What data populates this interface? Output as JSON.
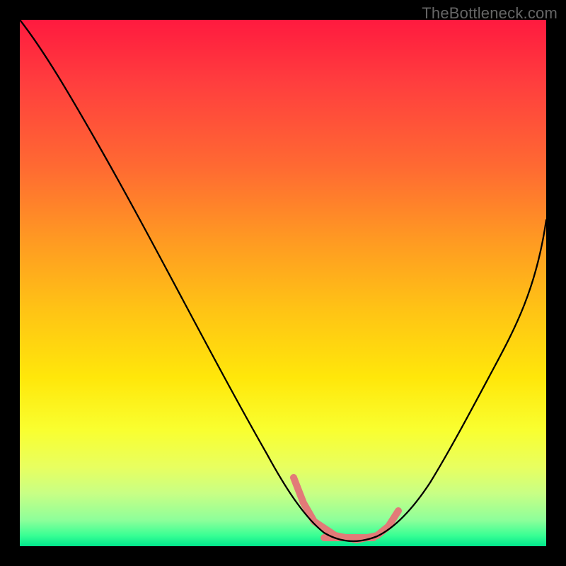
{
  "watermark": "TheBottleneck.com",
  "chart_data": {
    "type": "line",
    "title": "",
    "xlabel": "",
    "ylabel": "",
    "xlim": [
      0,
      100
    ],
    "ylim": [
      0,
      100
    ],
    "series": [
      {
        "name": "bottleneck-curve",
        "x": [
          0,
          6,
          12,
          18,
          24,
          30,
          36,
          42,
          48,
          52,
          56,
          60,
          64,
          68,
          72,
          76,
          80,
          85,
          90,
          95,
          100
        ],
        "values": [
          100,
          92,
          83,
          74,
          65,
          55,
          45,
          34,
          22,
          13,
          6,
          2,
          1,
          1,
          2,
          6,
          13,
          23,
          35,
          48,
          62
        ]
      }
    ],
    "highlight_range_x": [
      52,
      70
    ],
    "highlight_values": [
      13,
      6,
      2,
      1,
      1,
      2
    ],
    "background_gradient": {
      "top": "#ff1a3f",
      "mid": "#ffe70a",
      "bottom": "#00e68c"
    },
    "colors": {
      "curve": "#000000",
      "highlight": "#e27a78",
      "frame": "#000000"
    }
  }
}
